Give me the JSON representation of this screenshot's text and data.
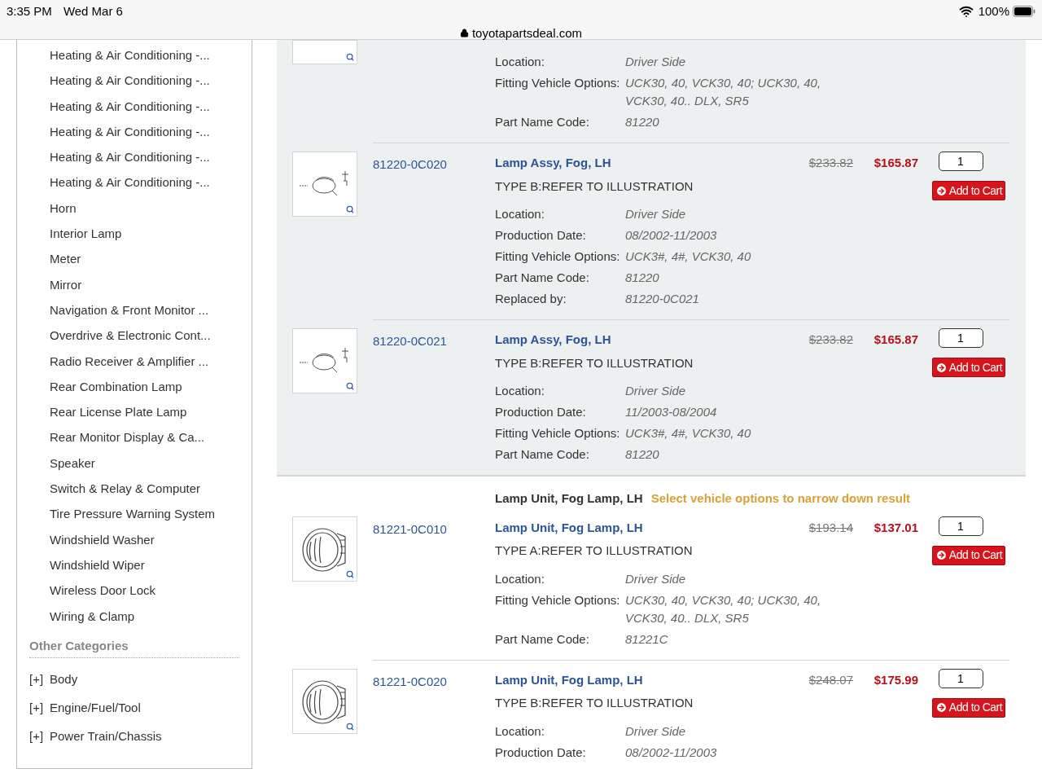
{
  "status_bar": {
    "time": "3:35 PM",
    "date": "Wed Mar 6",
    "battery": "100%"
  },
  "address_bar": {
    "url": "toyotapartsdeal.com"
  },
  "sidebar": {
    "items": [
      {
        "label": "Heating & Air Conditioning -..."
      },
      {
        "label": "Heating & Air Conditioning -..."
      },
      {
        "label": "Heating & Air Conditioning -..."
      },
      {
        "label": "Heating & Air Conditioning -..."
      },
      {
        "label": "Heating & Air Conditioning -..."
      },
      {
        "label": "Heating & Air Conditioning -..."
      },
      {
        "label": "Horn"
      },
      {
        "label": "Interior Lamp"
      },
      {
        "label": "Meter"
      },
      {
        "label": "Mirror"
      },
      {
        "label": "Navigation & Front Monitor ..."
      },
      {
        "label": "Overdrive & Electronic Cont..."
      },
      {
        "label": "Radio Receiver & Amplifier ..."
      },
      {
        "label": "Rear Combination Lamp"
      },
      {
        "label": "Rear License Plate Lamp"
      },
      {
        "label": "Rear Monitor Display & Ca..."
      },
      {
        "label": "Speaker"
      },
      {
        "label": "Switch & Relay & Computer"
      },
      {
        "label": "Tire Pressure Warning System"
      },
      {
        "label": "Windshield Washer"
      },
      {
        "label": "Windshield Wiper"
      },
      {
        "label": "Wireless Door Lock"
      },
      {
        "label": "Wiring & Clamp"
      }
    ],
    "other_heading": "Other Categories",
    "other_items": [
      {
        "toggle": "[+]",
        "label": "Body"
      },
      {
        "toggle": "[+]",
        "label": "Engine/Fuel/Tool"
      },
      {
        "toggle": "[+]",
        "label": "Power Train/Chassis"
      }
    ]
  },
  "groups": [
    {
      "shaded": true,
      "rows": [
        {
          "kind": "assembly",
          "specs": [
            {
              "label": "Location:",
              "value": "Driver Side"
            },
            {
              "label": "Fitting Vehicle Options:",
              "value": "UCK30, 40, VCK30, 40; UCK30, 40, VCK30, 40.. DLX, SR5"
            },
            {
              "label": "Part Name Code:",
              "value": "81220"
            }
          ]
        },
        {
          "kind": "assembly",
          "part_number": "81220-0C020",
          "title": "Lamp Assy, Fog, LH",
          "subtitle": "TYPE B:REFER TO ILLUSTRATION",
          "old_price": "$233.82",
          "price": "$165.87",
          "qty": "1",
          "button": "Add to Cart",
          "specs": [
            {
              "label": "Location:",
              "value": "Driver Side"
            },
            {
              "label": "Production Date:",
              "value": "08/2002-11/2003"
            },
            {
              "label": "Fitting Vehicle Options:",
              "value": "UCK3#, 4#, VCK30, 40"
            },
            {
              "label": "Part Name Code:",
              "value": "81220"
            },
            {
              "label": "Replaced by:",
              "value": "81220-0C021"
            }
          ]
        },
        {
          "kind": "assembly",
          "part_number": "81220-0C021",
          "title": "Lamp Assy, Fog, LH",
          "subtitle": "TYPE B:REFER TO ILLUSTRATION",
          "old_price": "$233.82",
          "price": "$165.87",
          "qty": "1",
          "button": "Add to Cart",
          "specs": [
            {
              "label": "Location:",
              "value": "Driver Side"
            },
            {
              "label": "Production Date:",
              "value": "11/2003-08/2004"
            },
            {
              "label": "Fitting Vehicle Options:",
              "value": "UCK3#, 4#, VCK30, 40"
            },
            {
              "label": "Part Name Code:",
              "value": "81220"
            }
          ]
        }
      ]
    },
    {
      "shaded": false,
      "header": {
        "title": "Lamp Unit, Fog Lamp, LH",
        "hint": "Select vehicle options to narrow down result"
      },
      "rows": [
        {
          "kind": "lamp",
          "part_number": "81221-0C010",
          "title": "Lamp Unit, Fog Lamp, LH",
          "subtitle": "TYPE A:REFER TO ILLUSTRATION",
          "old_price": "$193.14",
          "price": "$137.01",
          "qty": "1",
          "button": "Add to Cart",
          "specs": [
            {
              "label": "Location:",
              "value": "Driver Side"
            },
            {
              "label": "Fitting Vehicle Options:",
              "value": "UCK30, 40, VCK30, 40; UCK30, 40, VCK30, 40.. DLX, SR5"
            },
            {
              "label": "Part Name Code:",
              "value": "81221C"
            }
          ]
        },
        {
          "kind": "lamp",
          "part_number": "81221-0C020",
          "title": "Lamp Unit, Fog Lamp, LH",
          "subtitle": "TYPE B:REFER TO ILLUSTRATION",
          "old_price": "$248.07",
          "price": "$175.99",
          "qty": "1",
          "button": "Add to Cart",
          "specs": [
            {
              "label": "Location:",
              "value": "Driver Side"
            },
            {
              "label": "Production Date:",
              "value": "08/2002-11/2003"
            }
          ]
        }
      ]
    }
  ]
}
